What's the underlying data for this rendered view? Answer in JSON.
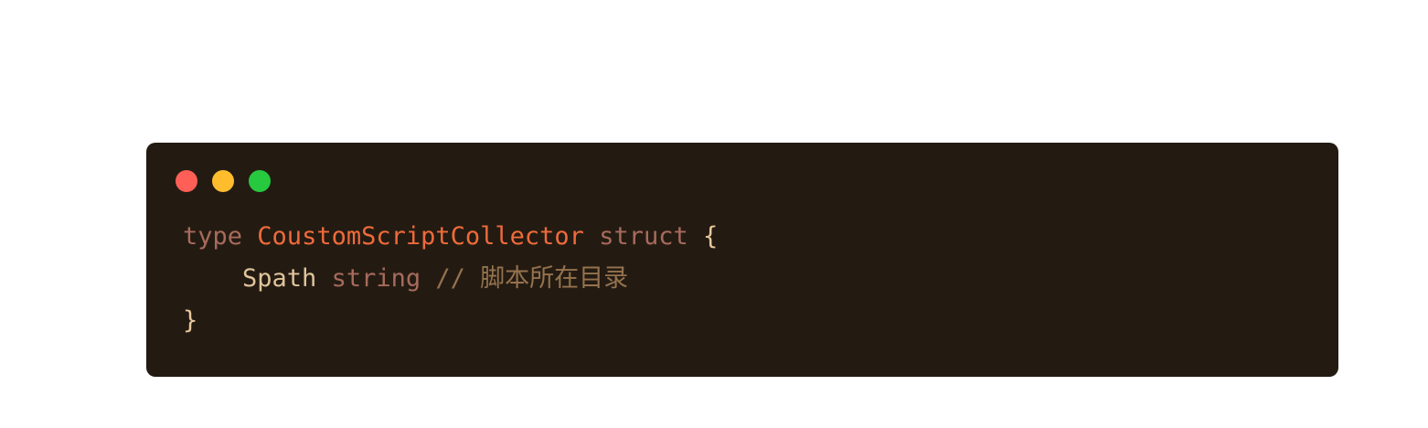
{
  "window": {
    "background": "#231b12",
    "controls": {
      "close_color": "#ff5f56",
      "minimize_color": "#ffbd2e",
      "maximize_color": "#27c93f"
    }
  },
  "code": {
    "colors": {
      "keyword": "#a86a5c",
      "type_name": "#ef6a3b",
      "punctuation": "#e8c79c",
      "field": "#e0c49c",
      "comment": "#95724d"
    },
    "lines": [
      {
        "indent": "",
        "tokens": [
          {
            "kind": "keyword",
            "text": "type"
          },
          {
            "kind": "space",
            "text": " "
          },
          {
            "kind": "type_name",
            "text": "CoustomScriptCollector"
          },
          {
            "kind": "space",
            "text": " "
          },
          {
            "kind": "keyword",
            "text": "struct"
          },
          {
            "kind": "space",
            "text": " "
          },
          {
            "kind": "punctuation",
            "text": "{"
          }
        ]
      },
      {
        "indent": "    ",
        "tokens": [
          {
            "kind": "field",
            "text": "Spath"
          },
          {
            "kind": "space",
            "text": " "
          },
          {
            "kind": "keyword",
            "text": "string"
          },
          {
            "kind": "space",
            "text": " "
          },
          {
            "kind": "comment",
            "text": "// 脚本所在目录"
          }
        ]
      },
      {
        "indent": "",
        "tokens": [
          {
            "kind": "punctuation",
            "text": "}"
          }
        ]
      }
    ]
  }
}
